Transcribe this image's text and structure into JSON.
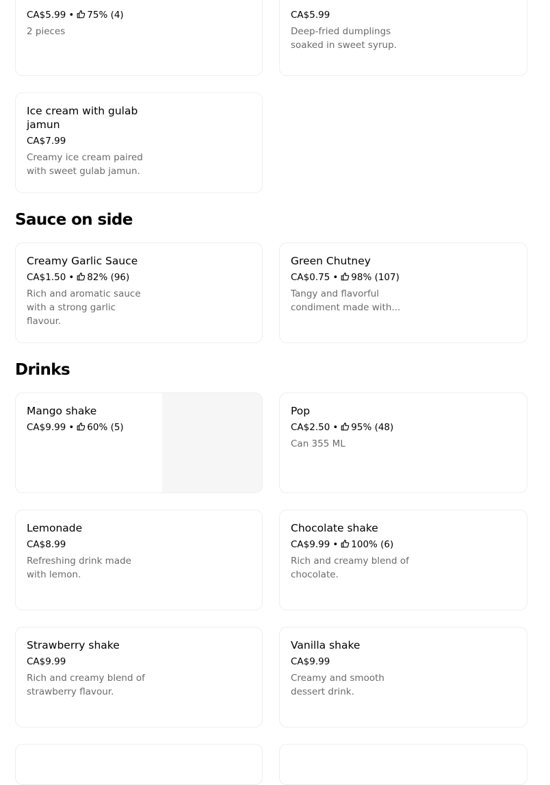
{
  "items_top": {
    "partial_left": {
      "price": "CA$5.99",
      "rating": "75% (4)",
      "description": "2 pieces"
    },
    "partial_right": {
      "price": "CA$5.99",
      "description": "Deep-fried dumplings soaked in sweet syrup."
    },
    "ice_cream": {
      "name": "Ice cream with gulab jamun",
      "price": "CA$7.99",
      "description": "Creamy ice cream paired with sweet gulab jamun."
    }
  },
  "sauce_section": {
    "title": "Sauce on side",
    "items": [
      {
        "name": "Creamy Garlic Sauce",
        "price": "CA$1.50",
        "rating": "82% (96)",
        "description": "Rich and aromatic sauce with a strong garlic flavour."
      },
      {
        "name": "Green Chutney",
        "price": "CA$0.75",
        "rating": "98% (107)",
        "description": "Tangy and flavorful condiment made with..."
      }
    ]
  },
  "drinks_section": {
    "title": "Drinks",
    "items": [
      {
        "name": "Mango shake",
        "price": "CA$9.99",
        "rating": "60% (5)"
      },
      {
        "name": "Pop",
        "price": "CA$2.50",
        "rating": "95% (48)",
        "description": "Can 355 ML"
      },
      {
        "name": "Lemonade",
        "price": "CA$8.99",
        "description": "Refreshing drink made with lemon."
      },
      {
        "name": "Chocolate shake",
        "price": "CA$9.99",
        "rating": "100% (6)",
        "description": "Rich and creamy blend of chocolate."
      },
      {
        "name": "Strawberry shake",
        "price": "CA$9.99",
        "description": "Rich and creamy blend of strawberry flavour."
      },
      {
        "name": "Vanilla shake",
        "price": "CA$9.99",
        "description": "Creamy and smooth dessert drink."
      }
    ]
  },
  "separator": "•",
  "icons": {
    "rating": "thumbs-up-icon"
  },
  "colors": {
    "text": "#000000",
    "muted": "#6b6b6b",
    "border": "#eeeeee",
    "image_placeholder": "#f6f6f6"
  }
}
